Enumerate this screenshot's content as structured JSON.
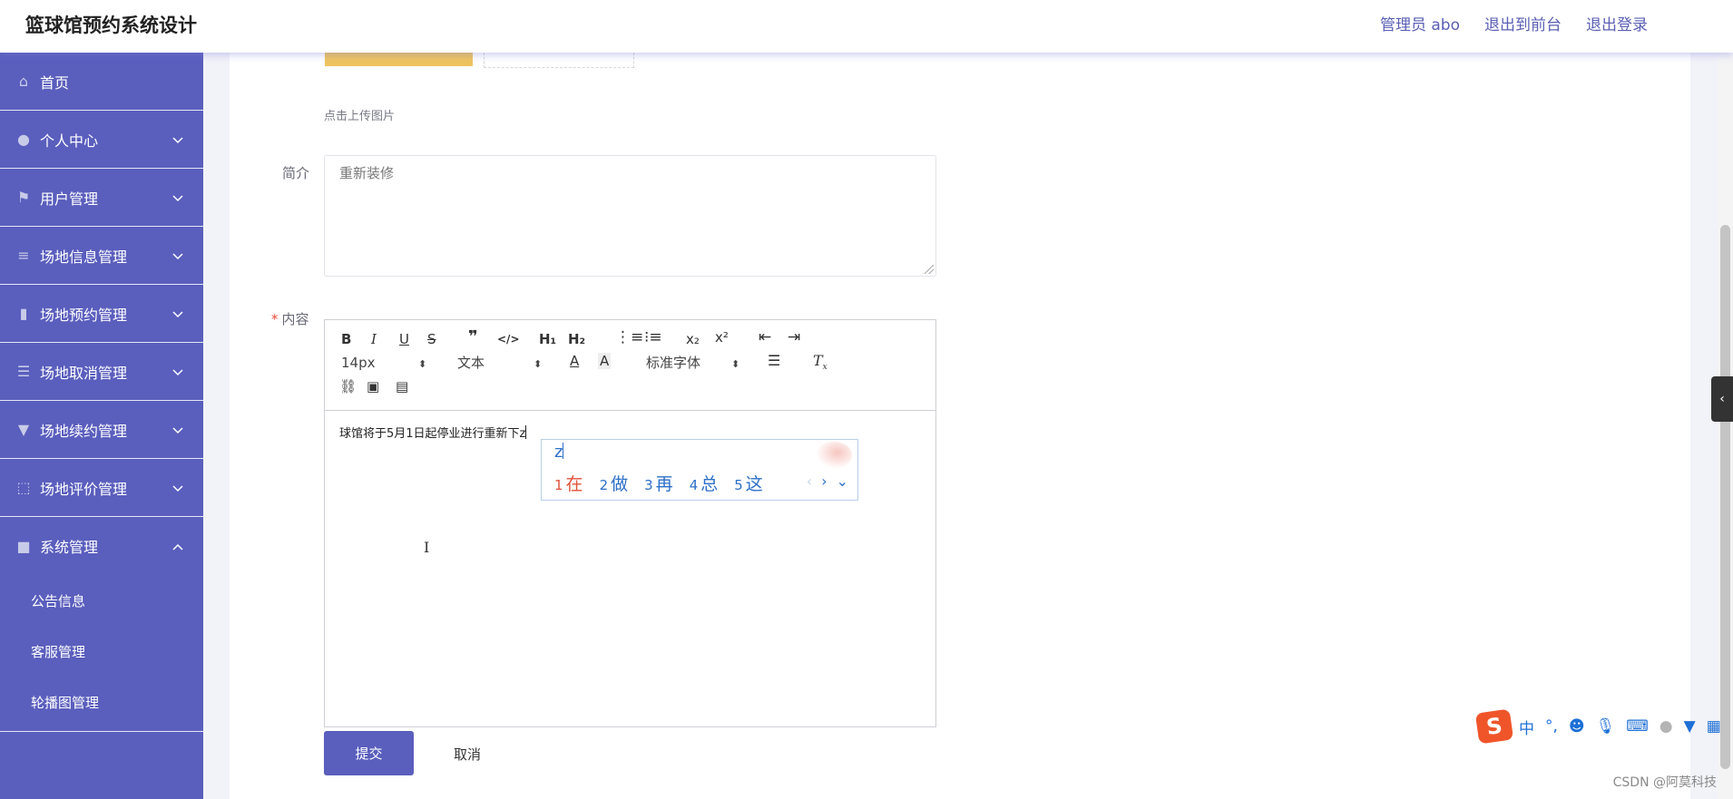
{
  "app": {
    "title": "篮球馆预约系统设计"
  },
  "header": {
    "links": [
      "管理员 abo",
      "退出到前台",
      "退出登录"
    ]
  },
  "sidebar": {
    "items": [
      {
        "label": "首页",
        "icon": "home-icon",
        "glyph": "⌂",
        "expandable": false
      },
      {
        "label": "个人中心",
        "icon": "user-icon",
        "glyph": "●",
        "expandable": true
      },
      {
        "label": "用户管理",
        "icon": "flag-icon",
        "glyph": "⚑",
        "expandable": true
      },
      {
        "label": "场地信息管理",
        "icon": "sliders-icon",
        "glyph": "≡",
        "expandable": true
      },
      {
        "label": "场地预约管理",
        "icon": "building-icon",
        "glyph": "▮",
        "expandable": true
      },
      {
        "label": "场地取消管理",
        "icon": "list-icon",
        "glyph": "☰",
        "expandable": true
      },
      {
        "label": "场地续约管理",
        "icon": "trophy-icon",
        "glyph": "▼",
        "expandable": true
      },
      {
        "label": "场地评价管理",
        "icon": "frame-icon",
        "glyph": "⬚",
        "expandable": true
      },
      {
        "label": "系统管理",
        "icon": "briefcase-icon",
        "glyph": "■",
        "expandable": true,
        "open": true
      }
    ],
    "sub_items": [
      "公告信息",
      "客服管理",
      "轮播图管理"
    ]
  },
  "form": {
    "upload_hint": "点击上传图片",
    "intro_label": "简介",
    "intro_value": "重新装修",
    "content_label": "内容",
    "required_mark": "*",
    "content_text": "球馆将于5月1日起停业进行重新下z",
    "submit_label": "提交",
    "cancel_label": "取消"
  },
  "editor": {
    "font_size": "14px",
    "block_type": "文本",
    "font_family": "标准字体",
    "subscript": "x₂",
    "superscript": "x²",
    "h1": "H₁",
    "h2": "H₂"
  },
  "ime_popup": {
    "composition": "z",
    "candidates": [
      {
        "num": "1",
        "text": "在"
      },
      {
        "num": "2",
        "text": "做"
      },
      {
        "num": "3",
        "text": "再"
      },
      {
        "num": "4",
        "text": "总"
      },
      {
        "num": "5",
        "text": "这"
      }
    ]
  },
  "ime_bar": {
    "logo": "S",
    "lang": "中",
    "punct": "°,"
  },
  "watermark": "CSDN @阿莫科技",
  "colors": {
    "accent": "#5a5ebd",
    "upload": "#eec45f",
    "ime_blue": "#2d6fc8",
    "ime_first": "#e0523b"
  }
}
